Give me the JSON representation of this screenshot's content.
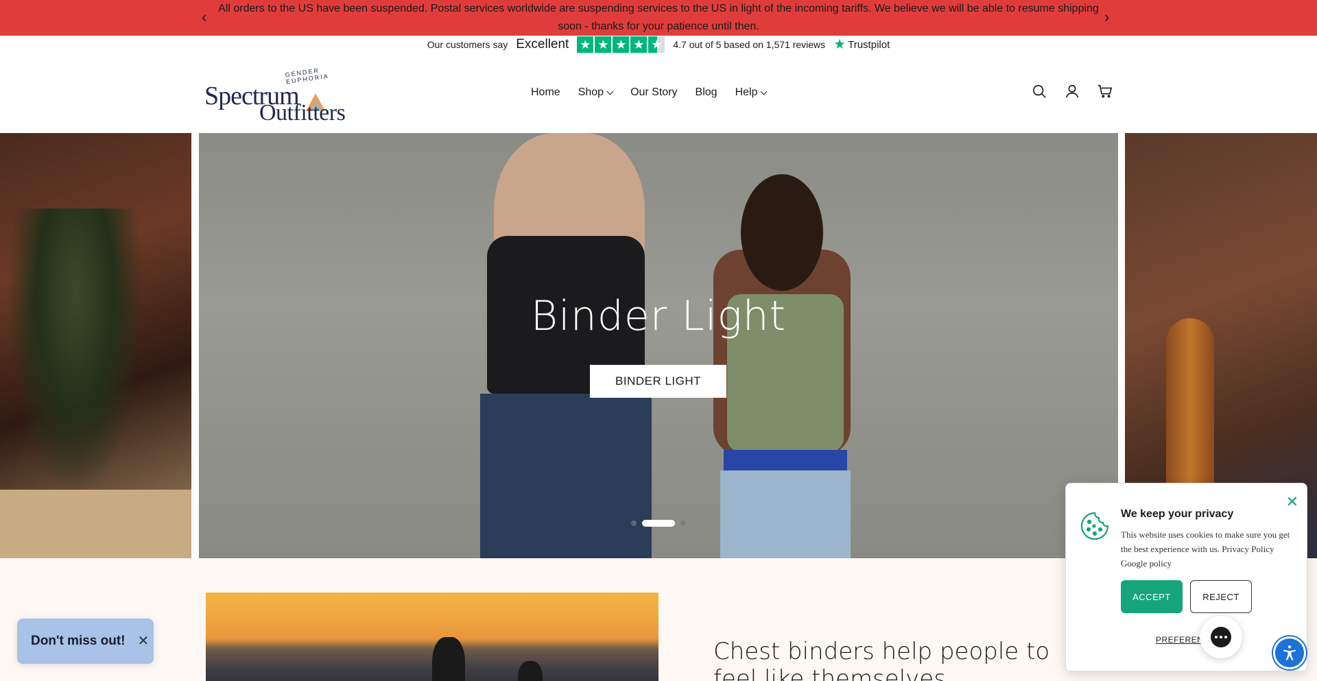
{
  "announcement": {
    "text": "All orders to the US have been suspended. Postal services worldwide are suspending services to the US in light of the incoming tariffs. We believe we will be able to resume shipping soon - thanks for your patience until then.",
    "prev_icon": "chevron-left-icon",
    "next_icon": "chevron-right-icon",
    "bg_color": "#e03c3c"
  },
  "trustpilot": {
    "say": "Our customers say",
    "rating_word": "Excellent",
    "stars": 4.7,
    "summary": "4.7 out of 5 based on 1,571 reviews",
    "brand": "Trustpilot",
    "star_color": "#00b67a"
  },
  "logo": {
    "line1": "Spectrum",
    "line2": "Outfitters",
    "tagline": "GENDER EUPHORIA"
  },
  "nav": {
    "home": "Home",
    "shop": "Shop",
    "story": "Our Story",
    "blog": "Blog",
    "help": "Help"
  },
  "header_icons": [
    "search-icon",
    "account-icon",
    "cart-icon"
  ],
  "hero": {
    "title": "Binder Light",
    "button": "BINDER LIGHT",
    "slide_count": 3,
    "active_slide": 2
  },
  "lower": {
    "heading": "Chest binders help people to feel like themselves"
  },
  "popup": {
    "dont_miss": "Don't miss out!"
  },
  "privacy": {
    "title": "We keep your privacy",
    "body": "This website uses cookies to make sure you get the best experience with us. Privacy Policy  Google policy",
    "accept": "ACCEPT",
    "reject": "REJECT",
    "preferences": "PREFERENC",
    "accent_color": "#16a57a"
  }
}
